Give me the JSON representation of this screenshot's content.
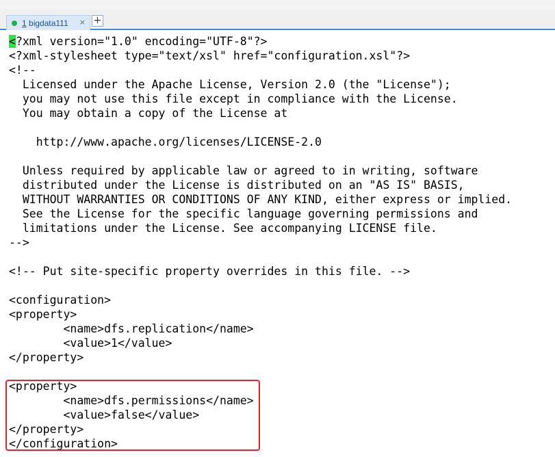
{
  "tabs": [
    {
      "number": "1",
      "label": "bigdata111",
      "status_color": "#21b24b",
      "close_icon": "×"
    }
  ],
  "add_tab_icon": "+",
  "editor": {
    "cursor_char": "<",
    "lines": [
      "?xml version=\"1.0\" encoding=\"UTF-8\"?>",
      "<?xml-stylesheet type=\"text/xsl\" href=\"configuration.xsl\"?>",
      "<!--",
      "  Licensed under the Apache License, Version 2.0 (the \"License\");",
      "  you may not use this file except in compliance with the License.",
      "  You may obtain a copy of the License at",
      "",
      "    http://www.apache.org/licenses/LICENSE-2.0",
      "",
      "  Unless required by applicable law or agreed to in writing, software",
      "  distributed under the License is distributed on an \"AS IS\" BASIS,",
      "  WITHOUT WARRANTIES OR CONDITIONS OF ANY KIND, either express or implied.",
      "  See the License for the specific language governing permissions and",
      "  limitations under the License. See accompanying LICENSE file.",
      "-->",
      "",
      "<!-- Put site-specific property overrides in this file. -->",
      "",
      "<configuration>",
      "<property>",
      "        <name>dfs.replication</name>",
      "        <value>1</value>",
      "</property>",
      "",
      "<property>",
      "        <name>dfs.permissions</name>",
      "        <value>false</value>",
      "</property>",
      "</configuration>"
    ]
  },
  "highlight_color": "#e8202b"
}
